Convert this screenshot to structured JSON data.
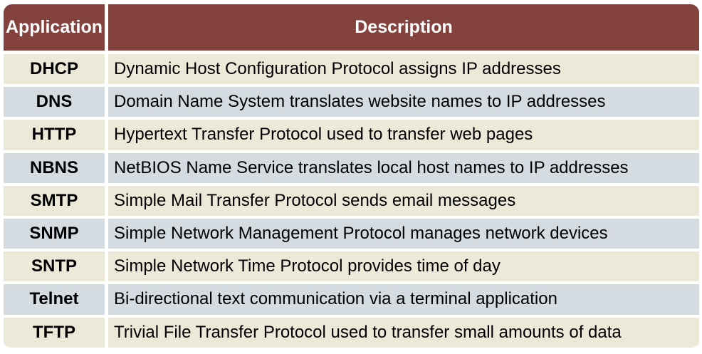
{
  "table": {
    "headers": {
      "application": "Application",
      "description": "Description"
    },
    "rows": [
      {
        "application": "DHCP",
        "description": "Dynamic Host Configuration Protocol assigns IP addresses"
      },
      {
        "application": "DNS",
        "description": "Domain Name System translates website names to IP addresses"
      },
      {
        "application": "HTTP",
        "description": "Hypertext Transfer Protocol used to transfer web pages"
      },
      {
        "application": "NBNS",
        "description": "NetBIOS Name Service translates local host names to IP addresses"
      },
      {
        "application": "SMTP",
        "description": "Simple Mail Transfer Protocol sends email messages"
      },
      {
        "application": "SNMP",
        "description": "Simple Network Management Protocol manages network devices"
      },
      {
        "application": "SNTP",
        "description": "Simple Network Time Protocol provides time of day"
      },
      {
        "application": "Telnet",
        "description": "Bi-directional text communication via a terminal application"
      },
      {
        "application": "TFTP",
        "description": "Trivial File Transfer Protocol used to transfer small amounts of data"
      }
    ],
    "colors": {
      "header_bg": "#84423f",
      "row_odd_bg": "#ede9d9",
      "row_even_bg": "#d4dce1"
    }
  }
}
